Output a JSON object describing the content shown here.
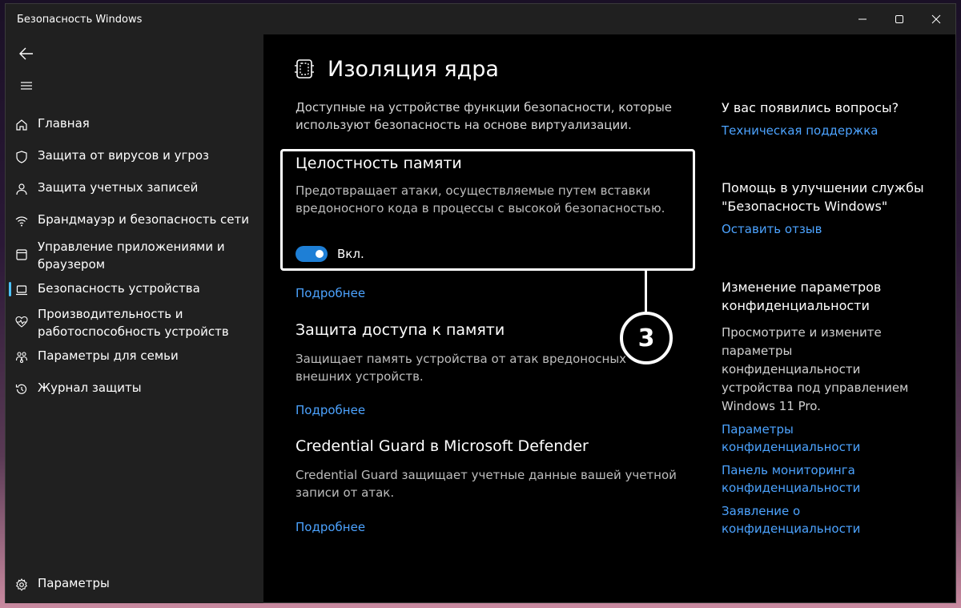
{
  "window": {
    "title": "Безопасность Windows"
  },
  "sidebar": {
    "items": [
      {
        "label": "Главная",
        "icon": "home-icon"
      },
      {
        "label": "Защита от вирусов и угроз",
        "icon": "shield-icon"
      },
      {
        "label": "Защита учетных записей",
        "icon": "person-icon"
      },
      {
        "label": "Брандмауэр и безопасность сети",
        "icon": "wifi-icon"
      },
      {
        "label": "Управление приложениями и браузером",
        "icon": "app-window-icon"
      },
      {
        "label": "Безопасность устройства",
        "icon": "laptop-icon",
        "active": true
      },
      {
        "label": "Производительность и работоспособность устройств",
        "icon": "heartbeat-icon"
      },
      {
        "label": "Параметры для семьи",
        "icon": "family-icon"
      },
      {
        "label": "Журнал защиты",
        "icon": "history-icon"
      }
    ],
    "settings_label": "Параметры"
  },
  "main": {
    "title": "Изоляция ядра",
    "intro": "Доступные на устройстве функции безопасности, которые используют безопасность на основе виртуализации.",
    "memory_integrity": {
      "title": "Целостность памяти",
      "description": "Предотвращает атаки, осуществляемые путем вставки вредоносного кода в процессы с высокой безопасностью.",
      "toggle_label": "Вкл.",
      "toggle_on": true,
      "link": "Подробнее"
    },
    "memory_access": {
      "title": "Защита доступа к памяти",
      "description": "Защищает память устройства от атак вредоносных внешних устройств.",
      "link": "Подробнее"
    },
    "credential_guard": {
      "title": "Credential Guard в Microsoft Defender",
      "description": "Credential Guard защищает учетные данные вашей учетной записи от атак.",
      "link": "Подробнее"
    },
    "step_badge": "3"
  },
  "right": {
    "questions": {
      "heading": "У вас появились вопросы?",
      "link": "Техническая поддержка"
    },
    "improve": {
      "heading": "Помощь в улучшении службы \"Безопасность Windows\"",
      "link": "Оставить отзыв"
    },
    "privacy": {
      "heading": "Изменение параметров конфиденциальности",
      "text": "Просмотрите и измените параметры конфиденциальности устройства под управлением Windows 11 Pro.",
      "links": [
        "Параметры конфиденциальности",
        "Панель мониторинга конфиденциальности",
        "Заявление о конфиденциальности"
      ]
    }
  },
  "colors": {
    "accent": "#4cc2ff",
    "link": "#4ca3ff",
    "toggle": "#1e7fd6",
    "sidebar_bg": "#202020",
    "main_bg": "#000000"
  }
}
